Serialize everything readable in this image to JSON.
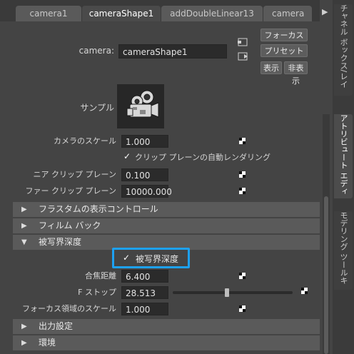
{
  "tabs": [
    {
      "label": "camera1"
    },
    {
      "label": "cameraShape1"
    },
    {
      "label": "addDoubleLinear13"
    },
    {
      "label": "camera"
    }
  ],
  "sidebar_tabs": [
    {
      "label": "チャネル ボックス/レイヤ エディタ"
    },
    {
      "label": "アトリビュート エディタ"
    },
    {
      "label": "モデリング ツールキット"
    }
  ],
  "header": {
    "node_type_label": "camera:",
    "node_name": "cameraShape1",
    "focus_button": "フォーカス",
    "preset_button": "プリセット",
    "show_button": "表示",
    "hide_button": "非表示",
    "sample_label": "サンプル"
  },
  "attributes_top": {
    "camera_scale": {
      "label": "カメラのスケール",
      "value": "1.000"
    },
    "auto_render_clip": {
      "label": "クリップ プレーンの自動レンダリング",
      "checked": true
    },
    "near_clip": {
      "label": "ニア クリップ プレーン",
      "value": "0.100"
    },
    "far_clip": {
      "label": "ファー クリップ プレーン",
      "value": "10000.000"
    }
  },
  "sections": {
    "frustum": "フラスタムの表示コントロール",
    "film_back": "フィルム バック",
    "dof": "被写界深度",
    "output": "出力設定",
    "environment": "環境"
  },
  "dof": {
    "enable": {
      "label": "被写界深度",
      "checked": true
    },
    "focus_distance": {
      "label": "合焦距離",
      "value": "6.400"
    },
    "f_stop": {
      "label": "F ストップ",
      "value": "28.513",
      "slider_fraction": 0.45
    },
    "focus_region_scale": {
      "label": "フォーカス領域のスケール",
      "value": "1.000"
    }
  },
  "colors": {
    "highlight": "#1da1f2",
    "panel_bg": "#444444",
    "section_bg": "#5a5a5a"
  }
}
